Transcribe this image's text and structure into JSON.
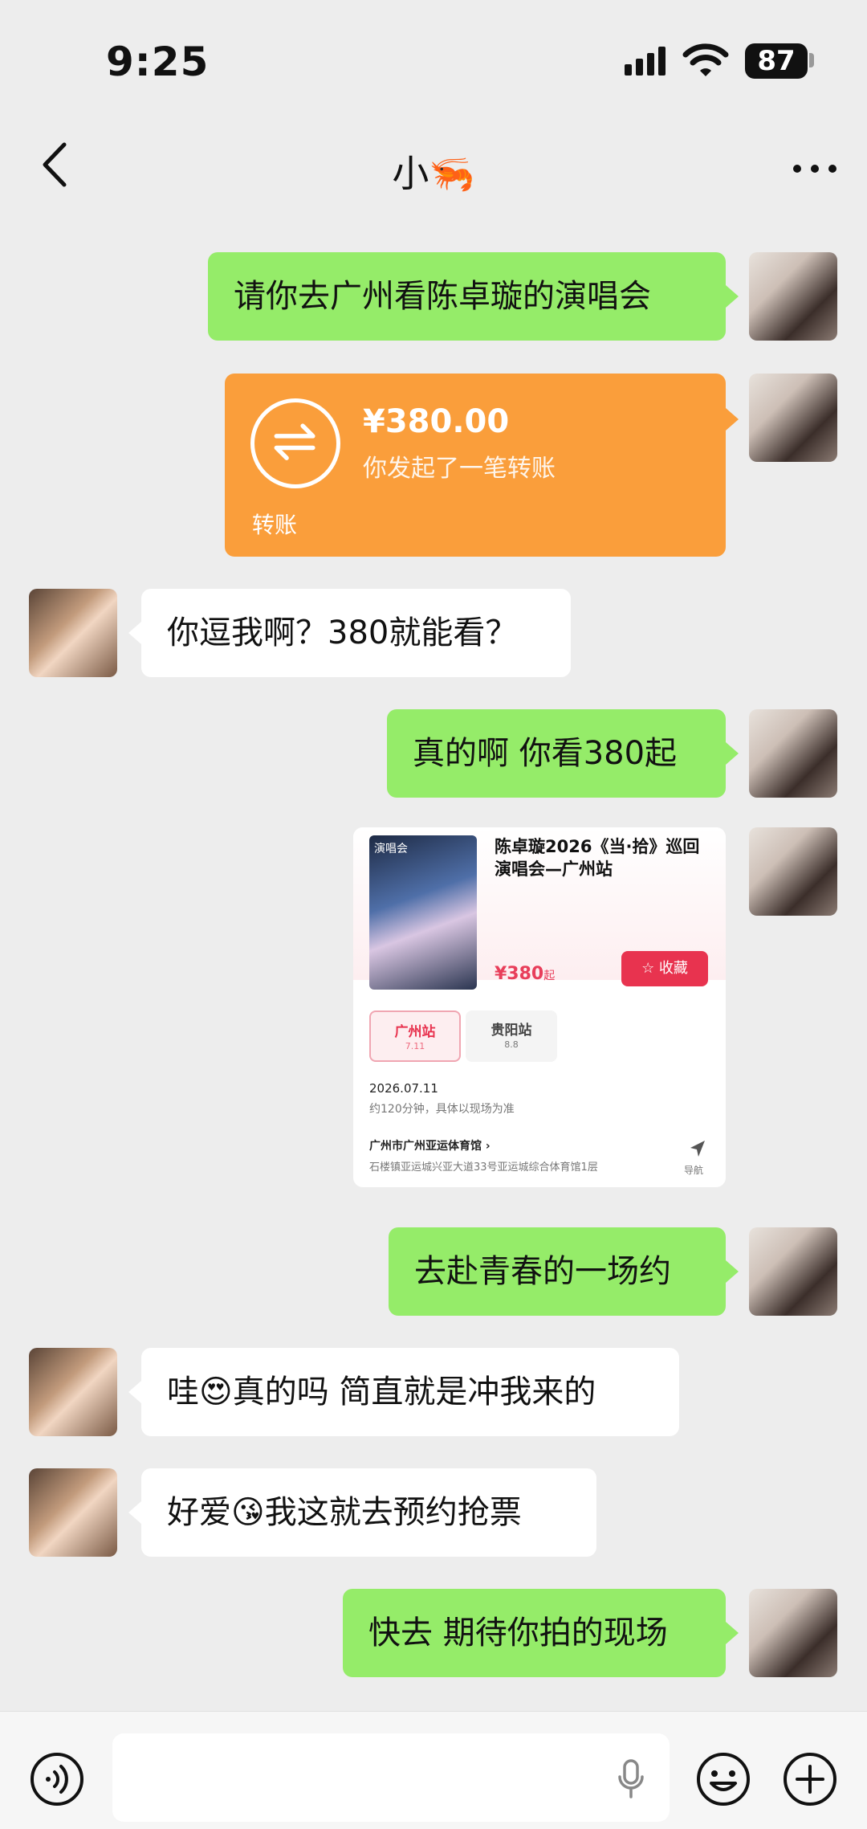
{
  "status_bar": {
    "time": "9:25",
    "battery": "87"
  },
  "header": {
    "title": "小🦐",
    "back_icon": "chevron-left-icon",
    "more_icon": "more-dots-icon"
  },
  "messages": [
    {
      "side": "self",
      "type": "text",
      "text": "请你去广州看陈卓璇的演唱会"
    },
    {
      "side": "self",
      "type": "transfer",
      "amount": "¥380.00",
      "description": "你发起了一笔转账",
      "label": "转账"
    },
    {
      "side": "other",
      "type": "text",
      "text": "你逗我啊？380就能看？"
    },
    {
      "side": "self",
      "type": "text",
      "text": "真的啊 你看380起"
    },
    {
      "side": "self",
      "type": "ticket",
      "poster_label": "演唱会",
      "title": "陈卓璇2026《当·拾》巡回演唱会—广州站",
      "price": "¥380",
      "price_suffix": "起",
      "favorite_label": "☆ 收藏",
      "sessions": [
        {
          "name": "广州站",
          "date": "7.11",
          "selected": true
        },
        {
          "name": "贵阳站",
          "date": "8.8",
          "selected": false
        }
      ],
      "date": "2026.07.11",
      "duration": "约120分钟，具体以现场为准",
      "venue": "广州市广州亚运体育馆 ›",
      "address": "石楼镇亚运城兴亚大道33号亚运城综合体育馆1层",
      "nav_label": "导航"
    },
    {
      "side": "self",
      "type": "text",
      "text": "去赴青春的一场约"
    },
    {
      "side": "other",
      "type": "text",
      "text": "哇😍真的吗 简直就是冲我来的"
    },
    {
      "side": "other",
      "type": "text",
      "text": "好爱😘我这就去预约抢票"
    },
    {
      "side": "self",
      "type": "text",
      "text": "快去 期待你拍的现场"
    }
  ],
  "input_bar": {
    "voice_icon": "voice-icon",
    "mic_icon": "mic-icon",
    "emoji_icon": "emoji-icon",
    "plus_icon": "plus-icon"
  },
  "colors": {
    "self_bubble": "#95ec69",
    "other_bubble": "#ffffff",
    "transfer": "#fa9e3b",
    "background": "#ededed"
  }
}
